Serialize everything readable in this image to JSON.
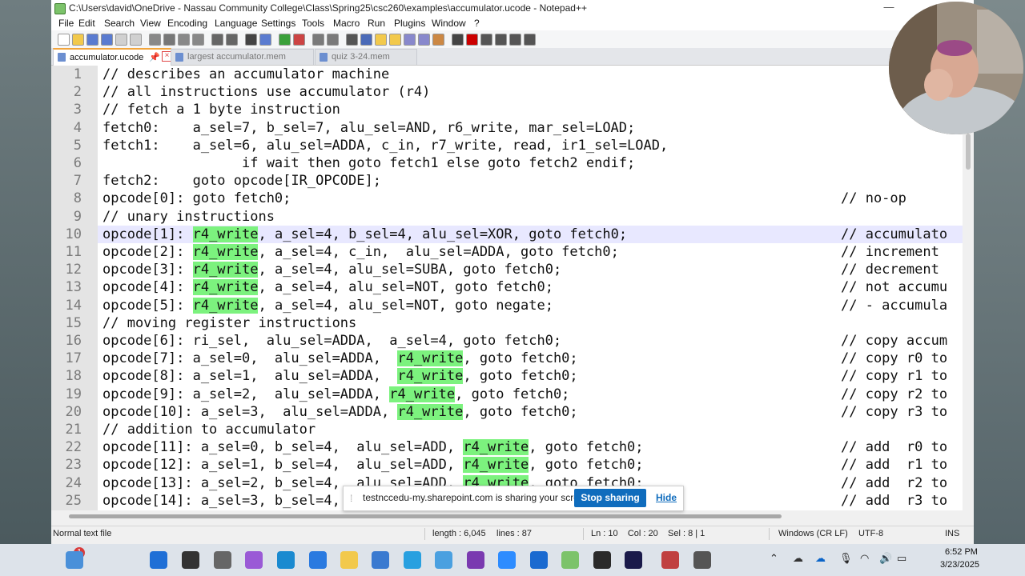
{
  "window": {
    "title": "C:\\Users\\david\\OneDrive - Nassau Community College\\Class\\Spring25\\csc260\\examples\\accumulator.ucode - Notepad++",
    "minimize_glyph": "—"
  },
  "menu": [
    "File",
    "Edit",
    "Search",
    "View",
    "Encoding",
    "Language",
    "Settings",
    "Tools",
    "Macro",
    "Run",
    "Plugins",
    "Window",
    "?"
  ],
  "tabs": [
    {
      "label": "accumulator.ucode",
      "active": true
    },
    {
      "label": "largest accumulator.mem",
      "active": false
    },
    {
      "label": "quiz 3-24.mem",
      "active": false
    }
  ],
  "editor": {
    "lines": [
      {
        "n": "1",
        "t": "// describes an accumulator machine"
      },
      {
        "n": "2",
        "t": "// all instructions use accumulator (r4)"
      },
      {
        "n": "3",
        "t": "// fetch a 1 byte instruction"
      },
      {
        "n": "4",
        "t": "fetch0:    a_sel=7, b_sel=7, alu_sel=AND, r6_write, mar_sel=LOAD;"
      },
      {
        "n": "5",
        "t": "fetch1:    a_sel=6, alu_sel=ADDA, c_in, r7_write, read, ir1_sel=LOAD,"
      },
      {
        "n": "6",
        "t": "                 if wait then goto fetch1 else goto fetch2 endif;"
      },
      {
        "n": "7",
        "t": "fetch2:    goto opcode[IR_OPCODE];"
      },
      {
        "n": "8",
        "t": "opcode[0]: goto fetch0;",
        "c": "// no-op"
      },
      {
        "n": "9",
        "t": "// unary instructions"
      },
      {
        "n": "10",
        "p": "opcode[1]: ",
        "h": "r4_write",
        "s": ", a_sel=4, b_sel=4, alu_sel=XOR, goto fetch0;",
        "c": "// accumulato"
      },
      {
        "n": "11",
        "p": "opcode[2]: ",
        "h": "r4_write",
        "s": ", a_sel=4, c_in,  alu_sel=ADDA, goto fetch0;",
        "c": "// increment"
      },
      {
        "n": "12",
        "p": "opcode[3]: ",
        "h": "r4_write",
        "s": ", a_sel=4, alu_sel=SUBA, goto fetch0;",
        "c": "// decrement"
      },
      {
        "n": "13",
        "p": "opcode[4]: ",
        "h": "r4_write",
        "s": ", a_sel=4, alu_sel=NOT, goto fetch0;",
        "c": "// not accumu"
      },
      {
        "n": "14",
        "p": "opcode[5]: ",
        "h": "r4_write",
        "s": ", a_sel=4, alu_sel=NOT, goto negate;",
        "c": "// - accumula"
      },
      {
        "n": "15",
        "t": "// moving register instructions"
      },
      {
        "n": "16",
        "t": "opcode[6]: ri_sel,  alu_sel=ADDA,  a_sel=4, goto fetch0;",
        "c": "// copy accum"
      },
      {
        "n": "17",
        "p": "opcode[7]: a_sel=0,  alu_sel=ADDA,  ",
        "h": "r4_write",
        "s": ", goto fetch0;",
        "c": "// copy r0 to"
      },
      {
        "n": "18",
        "p": "opcode[8]: a_sel=1,  alu_sel=ADDA,  ",
        "h": "r4_write",
        "s": ", goto fetch0;",
        "c": "// copy r1 to"
      },
      {
        "n": "19",
        "p": "opcode[9]: a_sel=2,  alu_sel=ADDA, ",
        "h": "r4_write",
        "s": ", goto fetch0;",
        "c": "// copy r2 to"
      },
      {
        "n": "20",
        "p": "opcode[10]: a_sel=3,  alu_sel=ADDA, ",
        "h": "r4_write",
        "s": ", goto fetch0;",
        "c": "// copy r3 to"
      },
      {
        "n": "21",
        "t": "// addition to accumulator"
      },
      {
        "n": "22",
        "p": "opcode[11]: a_sel=0, b_sel=4,  alu_sel=ADD, ",
        "h": "r4_write",
        "s": ", goto fetch0;",
        "c": "// add  r0 to"
      },
      {
        "n": "23",
        "p": "opcode[12]: a_sel=1, b_sel=4,  alu_sel=ADD, ",
        "h": "r4_write",
        "s": ", goto fetch0;",
        "c": "// add  r1 to"
      },
      {
        "n": "24",
        "p": "opcode[13]: a_sel=2, b_sel=4,  alu_sel=ADD, ",
        "h": "r4_write",
        "s": ", goto fetch0;",
        "c": "// add  r2 to"
      },
      {
        "n": "25",
        "p": "opcode[14]: a_sel=3, b_sel=4,  alu_sel=ADD, ",
        "h": "r4_write",
        "s": ", goto fetch0;",
        "c": "// add  r3 to"
      }
    ]
  },
  "status": {
    "type": "Normal text file",
    "length": "length : 6,045",
    "lines": "lines : 87",
    "pos": "Ln : 10    Col : 20    Sel : 8 | 1",
    "eol": "Windows (CR LF)",
    "enc": "UTF-8",
    "mode": "INS"
  },
  "share": {
    "text": "testnccedu-my.sharepoint.com is sharing your screen.",
    "stop": "Stop sharing",
    "hide": "Hide"
  },
  "taskbar": {
    "notification_count": "1",
    "time": "6:52 PM",
    "date": "3/23/2025",
    "accent": "#0f6cbd"
  }
}
